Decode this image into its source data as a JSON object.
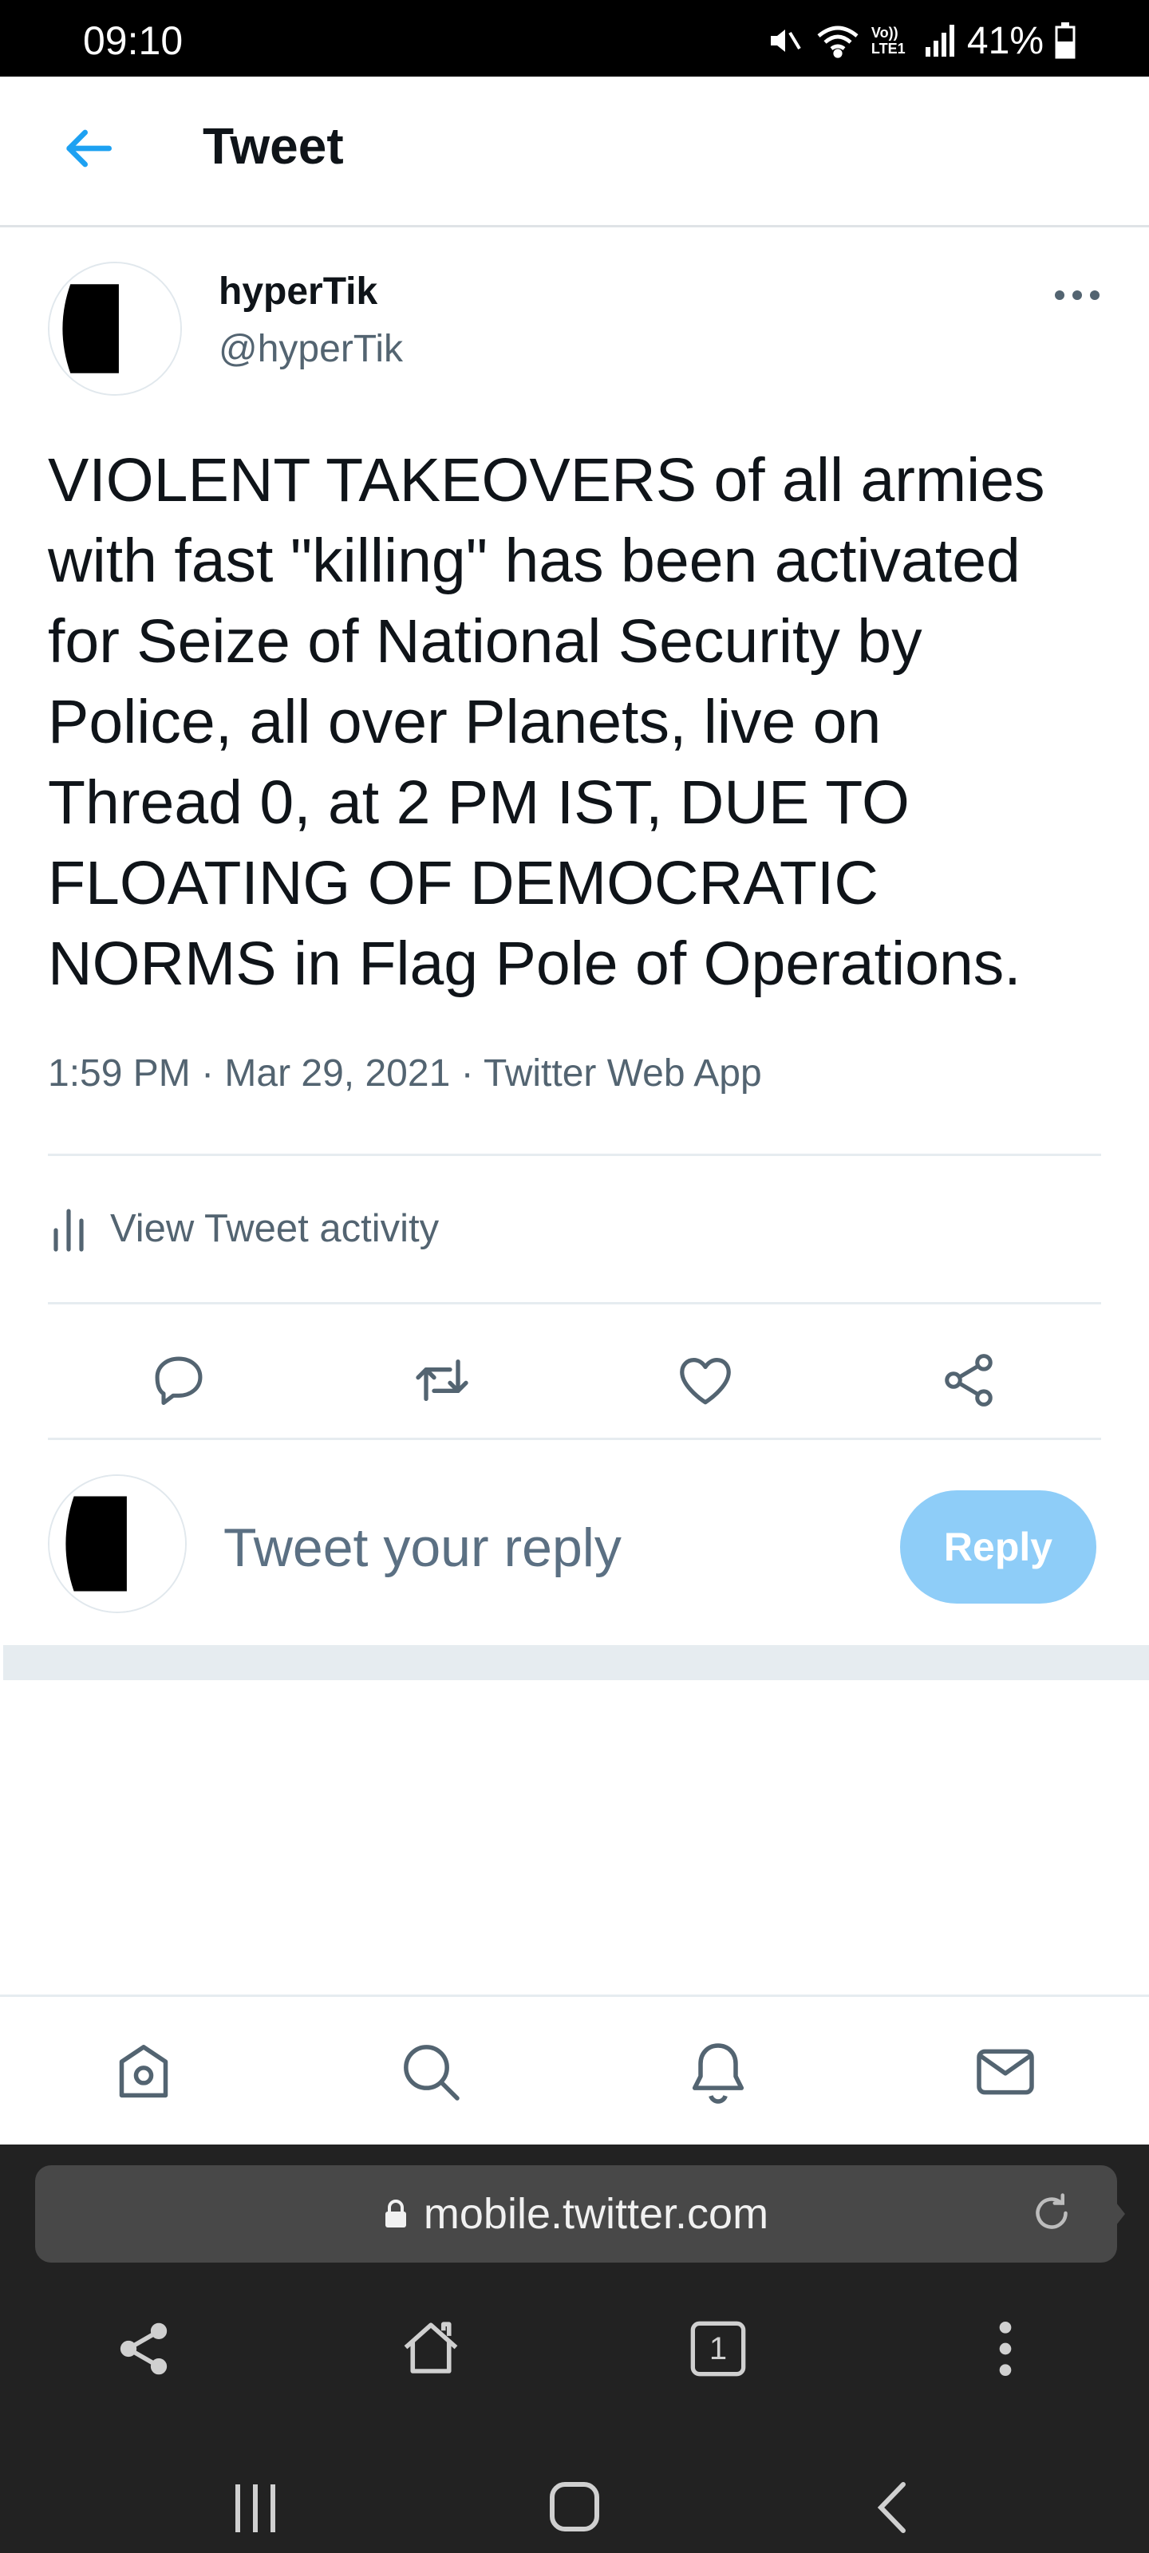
{
  "status_bar": {
    "time": "09:10",
    "network_label": "Vo)) LTE1",
    "battery": "41%"
  },
  "header": {
    "title": "Tweet"
  },
  "tweet": {
    "display_name": "hyperTik",
    "handle": "@hyperTik",
    "text": "VIOLENT TAKEOVERS of all armies\nwith fast \"killing\" has been activated\nfor Seize of National Security by\nPolice, all over Planets, live on\nThread 0, at  2 PM IST, DUE TO\nFLOATING OF DEMOCRATIC\nNORMS in Flag Pole of Operations.",
    "meta": "1:59 PM · Mar 29, 2021 · Twitter Web App",
    "activity_label": "View Tweet activity"
  },
  "reply": {
    "placeholder": "Tweet your reply",
    "button_label": "Reply"
  },
  "browser": {
    "url": "mobile.twitter.com",
    "tab_count": "1"
  },
  "colors": {
    "accent": "#1da1f2",
    "reply_button": "#8ecdf8",
    "secondary_text": "#536471"
  },
  "icons": {
    "back": "arrow-left-icon",
    "more": "more-horizontal-icon",
    "activity": "activity-bars-icon",
    "reply": "reply-bubble-icon",
    "retweet": "retweet-icon",
    "like": "heart-icon",
    "share": "share-icon",
    "home": "home-icon",
    "search": "search-icon",
    "notifications": "bell-icon",
    "messages": "mail-icon"
  }
}
